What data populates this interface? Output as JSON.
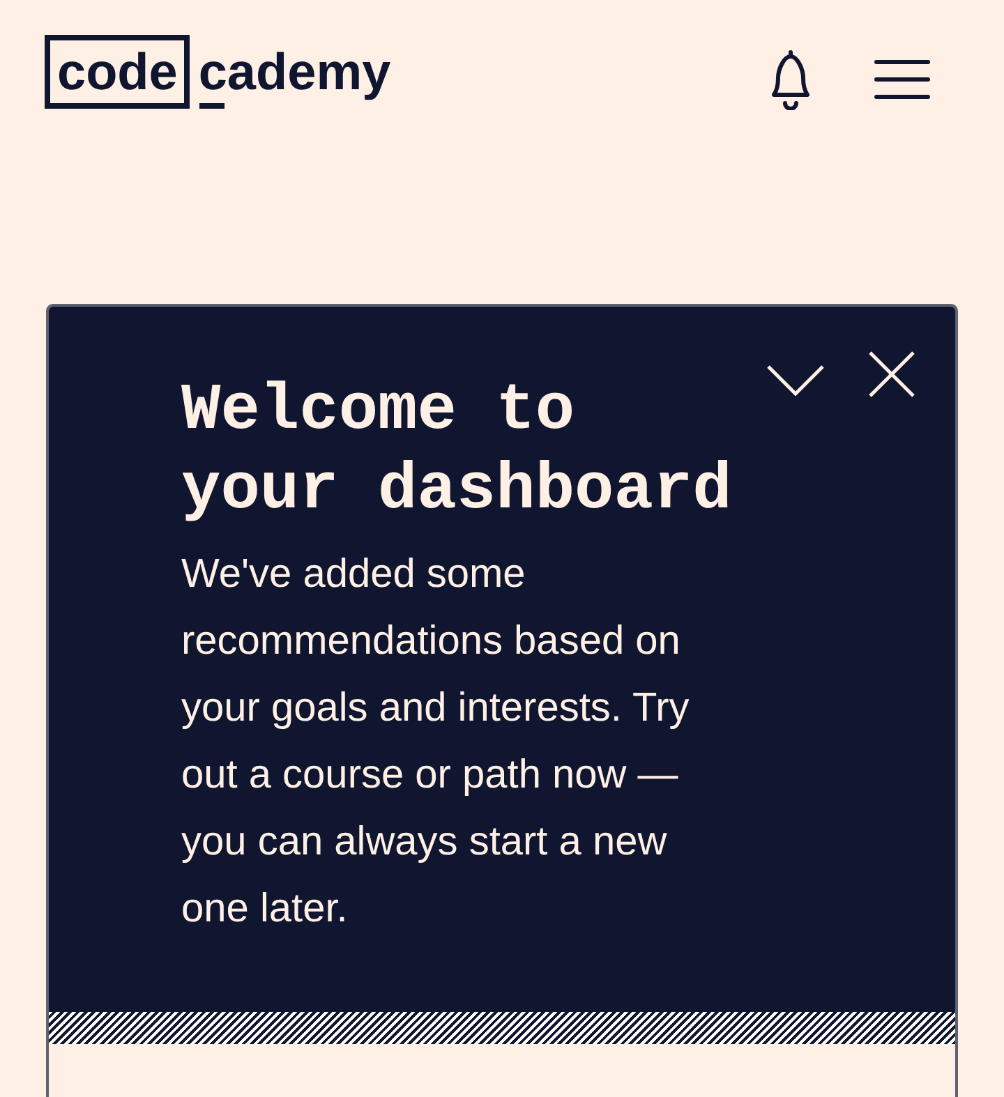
{
  "header": {
    "logo": {
      "boxed": "code",
      "rest": "cademy"
    }
  },
  "welcome_card": {
    "title": "Welcome to your dashboard",
    "body": "We've added some recommendations based on your goals and interests. Try out a course or path now — you can always start a new one later."
  }
}
